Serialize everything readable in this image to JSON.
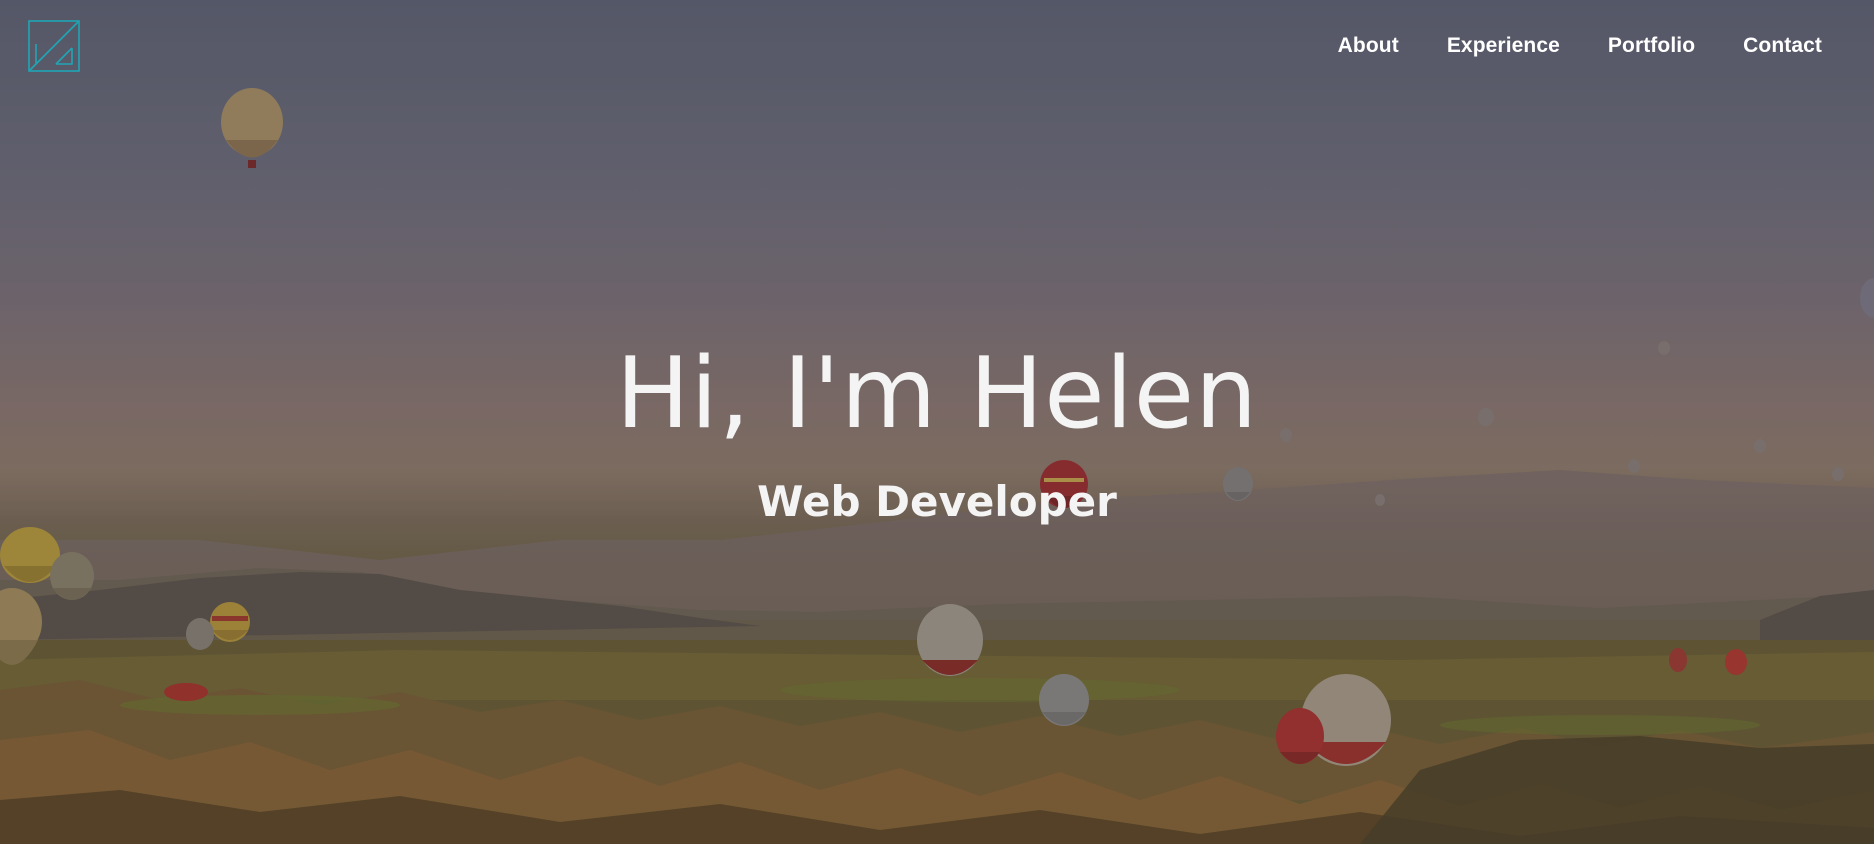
{
  "logo": {
    "icon": "square-slash-logo",
    "color": "#1fa6b5"
  },
  "nav": {
    "items": [
      {
        "label": "About"
      },
      {
        "label": "Experience"
      },
      {
        "label": "Portfolio"
      },
      {
        "label": "Contact"
      }
    ]
  },
  "hero": {
    "title": "Hi, I'm Helen",
    "subtitle": "Web Developer",
    "background": "hot-air-balloons-over-valley-image"
  }
}
